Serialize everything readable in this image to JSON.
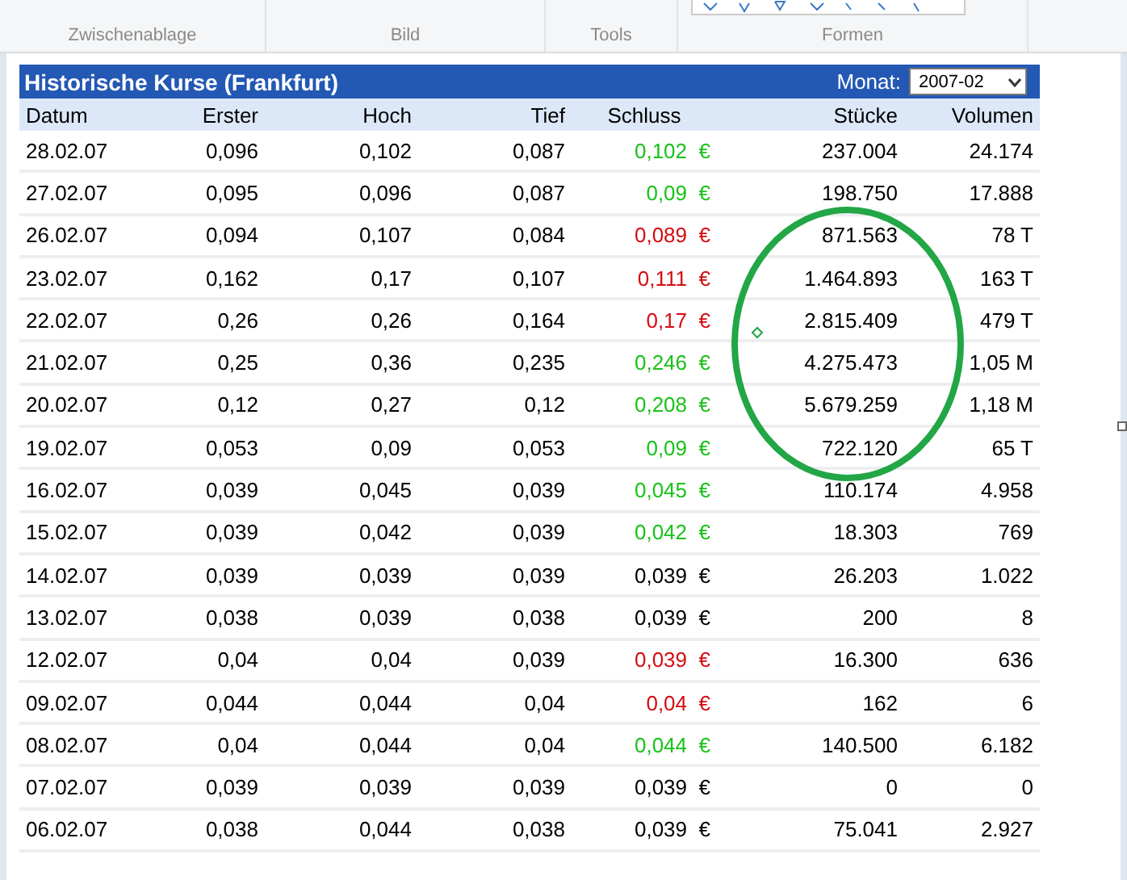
{
  "ribbon": {
    "groups": [
      "Zwischenablage",
      "Bild",
      "Tools",
      "Formen"
    ]
  },
  "table": {
    "title": "Historische Kurse (Frankfurt)",
    "month_label": "Monat:",
    "month_value": "2007-02",
    "columns": [
      "Datum",
      "Erster",
      "Hoch",
      "Tief",
      "Schluss",
      "Stücke",
      "Volumen"
    ],
    "currency": "€",
    "rows": [
      {
        "cells": [
          "28.02.07",
          "0,096",
          "0,102",
          "0,087",
          "0,102",
          "237.004",
          "24.174"
        ],
        "color": "#19c219"
      },
      {
        "cells": [
          "27.02.07",
          "0,095",
          "0,096",
          "0,087",
          "0,09",
          "198.750",
          "17.888"
        ],
        "color": "#19c219"
      },
      {
        "cells": [
          "26.02.07",
          "0,094",
          "0,107",
          "0,084",
          "0,089",
          "871.563",
          "78 T"
        ],
        "color": "#d40d12"
      },
      {
        "cells": [
          "23.02.07",
          "0,162",
          "0,17",
          "0,107",
          "0,111",
          "1.464.893",
          "163 T"
        ],
        "color": "#d40d12"
      },
      {
        "cells": [
          "22.02.07",
          "0,26",
          "0,26",
          "0,164",
          "0,17",
          "2.815.409",
          "479 T"
        ],
        "color": "#d40d12"
      },
      {
        "cells": [
          "21.02.07",
          "0,25",
          "0,36",
          "0,235",
          "0,246",
          "4.275.473",
          "1,05 M"
        ],
        "color": "#19c219"
      },
      {
        "cells": [
          "20.02.07",
          "0,12",
          "0,27",
          "0,12",
          "0,208",
          "5.679.259",
          "1,18 M"
        ],
        "color": "#19c219"
      },
      {
        "cells": [
          "19.02.07",
          "0,053",
          "0,09",
          "0,053",
          "0,09",
          "722.120",
          "65 T"
        ],
        "color": "#19c219"
      },
      {
        "cells": [
          "16.02.07",
          "0,039",
          "0,045",
          "0,039",
          "0,045",
          "110.174",
          "4.958"
        ],
        "color": "#19c219"
      },
      {
        "cells": [
          "15.02.07",
          "0,039",
          "0,042",
          "0,039",
          "0,042",
          "18.303",
          "769"
        ],
        "color": "#19c219"
      },
      {
        "cells": [
          "14.02.07",
          "0,039",
          "0,039",
          "0,039",
          "0,039",
          "26.203",
          "1.022"
        ],
        "color": "#000000"
      },
      {
        "cells": [
          "13.02.07",
          "0,038",
          "0,039",
          "0,038",
          "0,039",
          "200",
          "8"
        ],
        "color": "#000000"
      },
      {
        "cells": [
          "12.02.07",
          "0,04",
          "0,04",
          "0,039",
          "0,039",
          "16.300",
          "636"
        ],
        "color": "#d40d12"
      },
      {
        "cells": [
          "09.02.07",
          "0,044",
          "0,044",
          "0,04",
          "0,04",
          "162",
          "6"
        ],
        "color": "#d40d12"
      },
      {
        "cells": [
          "08.02.07",
          "0,04",
          "0,044",
          "0,04",
          "0,044",
          "140.500",
          "6.182"
        ],
        "color": "#19c219"
      },
      {
        "cells": [
          "07.02.07",
          "0,039",
          "0,039",
          "0,039",
          "0,039",
          "0",
          "0"
        ],
        "color": "#000000"
      },
      {
        "cells": [
          "06.02.07",
          "0,038",
          "0,044",
          "0,038",
          "0,039",
          "75.041",
          "2.927"
        ],
        "color": "#000000"
      }
    ]
  }
}
